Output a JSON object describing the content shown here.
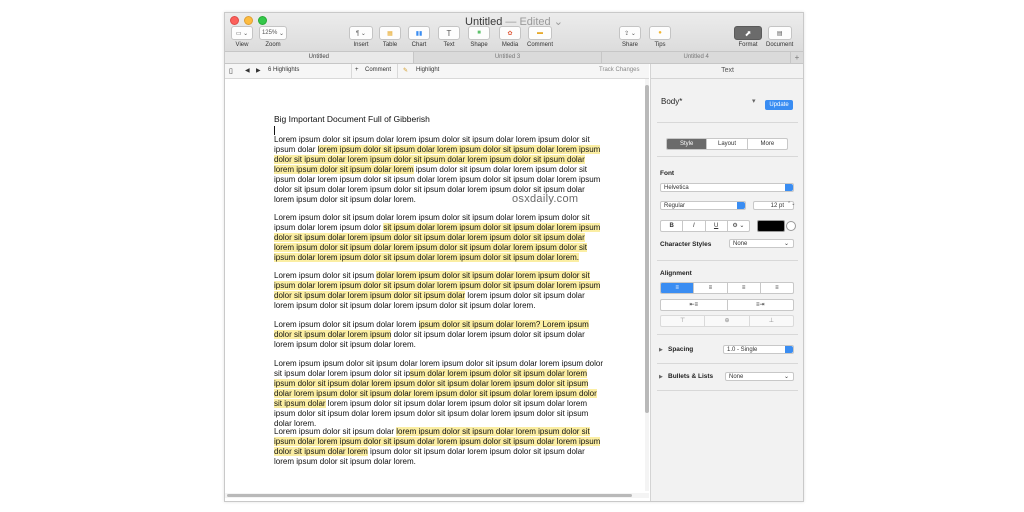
{
  "window": {
    "title": "Untitled",
    "title_sep": "—",
    "edited": "Edited",
    "title_caret": "⌄"
  },
  "toolbar": {
    "view": {
      "label": "View",
      "icon": "view-icon",
      "glyph": "▭ ⌄"
    },
    "zoom": {
      "label": "Zoom",
      "value": "125%",
      "caret": "⌄"
    },
    "insert": {
      "label": "Insert",
      "icon": "paragraph-icon",
      "glyph": "¶ ⌄"
    },
    "table": {
      "label": "Table",
      "icon": "table-icon",
      "glyph": "▦"
    },
    "chart": {
      "label": "Chart",
      "icon": "chart-icon",
      "glyph": "▮▮"
    },
    "text": {
      "label": "Text",
      "icon": "text-icon",
      "glyph": "T"
    },
    "shape": {
      "label": "Shape",
      "icon": "shape-icon",
      "glyph": "■"
    },
    "media": {
      "label": "Media",
      "icon": "media-icon",
      "glyph": "✿"
    },
    "comment": {
      "label": "Comment",
      "icon": "comment-icon",
      "glyph": "▬"
    },
    "share": {
      "label": "Share",
      "icon": "share-icon",
      "glyph": "⇪ ⌄"
    },
    "tips": {
      "label": "Tips",
      "icon": "tips-icon",
      "glyph": "●"
    },
    "format": {
      "label": "Format",
      "icon": "format-icon",
      "glyph": "⬈"
    },
    "document": {
      "label": "Document",
      "icon": "document-icon",
      "glyph": "▤"
    }
  },
  "tabs": [
    "Untitled",
    "Untitled 3",
    "Untitled 4"
  ],
  "tab_plus": "+",
  "subbar": {
    "sidebar_glyph": "▯",
    "prev_glyph": "◀",
    "next_glyph": "▶",
    "highlights": "6 Highlights",
    "comment_glyph": "+",
    "comment": "Comment",
    "highlight_glyph": "✎",
    "highlight": "Highlight",
    "track_changes": "Track Changes"
  },
  "document": {
    "heading": "Big Important Document Full of Gibberish",
    "watermark": "osxdaily.com",
    "paragraphs": [
      [
        {
          "t": "Lorem ipsum dolor sit ipsum dolar lorem ipsum dolor sit ipsum dolar lorem ipsum dolor sit ipsum dolar ",
          "h": false
        },
        {
          "t": "lorem ipsum dolor sit ipsum dolar lorem ipsum dolor sit ipsum dolar lorem ipsum dolor sit ipsum dolar lorem ipsum dolor sit ipsum dolar lorem ipsum dolor sit ipsum dolar lorem ipsum dolor sit ipsum dolar lorem",
          "h": true
        },
        {
          "t": " ipsum dolor sit ipsum dolar lorem ipsum dolor sit ipsum dolar lorem ipsum dolor sit ipsum dolar lorem ipsum dolor sit ipsum dolar lorem ipsum dolor sit ipsum dolar lorem ipsum dolor sit ipsum dolar lorem ipsum dolor sit ipsum dolar lorem ipsum dolor sit ipsum dolar lorem.",
          "h": false
        }
      ],
      [
        {
          "t": "Lorem ipsum dolor sit ipsum dolar lorem ipsum dolor sit ipsum dolar lorem ipsum dolor sit ipsum dolar lorem ipsum dolor ",
          "h": false
        },
        {
          "t": "sit ipsum dolar lorem ipsum dolor sit ipsum dolar lorem ipsum dolor sit ipsum dolar lorem ipsum dolor sit ipsum dolar lorem ipsum dolor sit ipsum dolar lorem ipsum dolor sit ipsum dolar lorem ipsum dolor sit ipsum dolar lorem ipsum dolor sit ipsum dolar lorem ipsum dolor sit ipsum dolar lorem ipsum dolor sit ipsum dolar lorem.",
          "h": true
        }
      ],
      [
        {
          "t": "Lorem ipsum dolor sit ipsum ",
          "h": false
        },
        {
          "t": "dolar lorem ipsum dolor sit ipsum dolar lorem ipsum dolor sit ipsum dolar lorem ipsum dolor sit ipsum dolar lorem ipsum dolor sit ipsum dolar lorem ipsum dolor sit ipsum dolar lorem ipsum dolor sit ipsum dolar",
          "h": true
        },
        {
          "t": " lorem ipsum dolor sit ipsum dolar lorem ipsum dolor sit ipsum dolar lorem ipsum dolor sit ipsum dolar lorem.",
          "h": false
        }
      ],
      [
        {
          "t": "Lorem ipsum dolor sit ipsum dolar lorem ",
          "h": false
        },
        {
          "t": "ipsum dolor sit ipsum dolar lorem? Lorem ipsum dolor sit ipsum dolar lorem ipsum",
          "h": true
        },
        {
          "t": " dolor sit ipsum dolar lorem ipsum dolor sit ipsum dolar lorem ipsum dolor sit ipsum dolar lorem.",
          "h": false
        }
      ],
      [
        {
          "t": "Lorem ipsum ipsum dolor sit ipsum dolar lorem ipsum dolor sit ipsum dolar lorem ipsum dolor sit ipsum dolar lorem ipsum dolor sit ip",
          "h": false
        },
        {
          "t": "sum dolar lorem ipsum dolor sit ipsum dolar lorem ipsum dolor sit ipsum dolar lorem ipsum dolor sit ipsum dolar lorem ipsum dolor sit ipsum dolar lorem ipsum dolor sit ipsum dolar lorem ipsum dolor sit ipsum dolar lorem ipsum dolor sit ipsum dolar",
          "h": true
        },
        {
          "t": " lorem ipsum dolor sit ipsum dolar lorem ipsum dolor sit ipsum dolar lorem ipsum dolor sit ipsum dolar lorem ipsum dolor sit ipsum dolar lorem ipsum dolor sit ipsum dolar lorem.",
          "h": false
        }
      ],
      [
        {
          "t": "Lorem ipsum dolor sit ipsum dolar ",
          "h": false
        },
        {
          "t": "lorem ipsum dolor sit ipsum dolar lorem ipsum dolor sit ipsum dolar lorem ipsum dolor sit ipsum dolar lorem ipsum dolor sit ipsum dolar lorem ipsum dolor sit ipsum dolar lorem",
          "h": true
        },
        {
          "t": " ipsum dolor sit ipsum dolar lorem ipsum dolor sit ipsum dolar lorem ipsum dolor sit ipsum dolar lorem.",
          "h": false
        }
      ]
    ]
  },
  "panel": {
    "header": "Text",
    "style_name": "Body*",
    "update": "Update",
    "style_caret": "▾",
    "seg_tabs": [
      "Style",
      "Layout",
      "More"
    ],
    "font_title": "Font",
    "font_family": "Helvetica",
    "font_style": "Regular",
    "font_size": "12 pt",
    "bius": [
      "B",
      "I",
      "U",
      "⚙ ⌄"
    ],
    "char_styles_label": "Character Styles",
    "char_styles_value": "None",
    "alignment_title": "Alignment",
    "align_buttons": [
      "≡",
      "≡",
      "≡",
      "≡"
    ],
    "indent_buttons": [
      "⇤≡",
      "≡⇥"
    ],
    "valign_buttons": [
      "⊤",
      "⊕",
      "⊥"
    ],
    "spacing_label": "Spacing",
    "spacing_value": "1.0 - Single",
    "bullets_label": "Bullets & Lists",
    "bullets_value": "None",
    "disclosure_glyph": "▶",
    "popup_caret": "⌄",
    "stepper_glyph": "⌃⌄"
  },
  "colors": {
    "highlight": "#fbeea3",
    "accent": "#3a8df2",
    "active_button": "#6b6b6b",
    "text_color_swatch": "#000000"
  }
}
